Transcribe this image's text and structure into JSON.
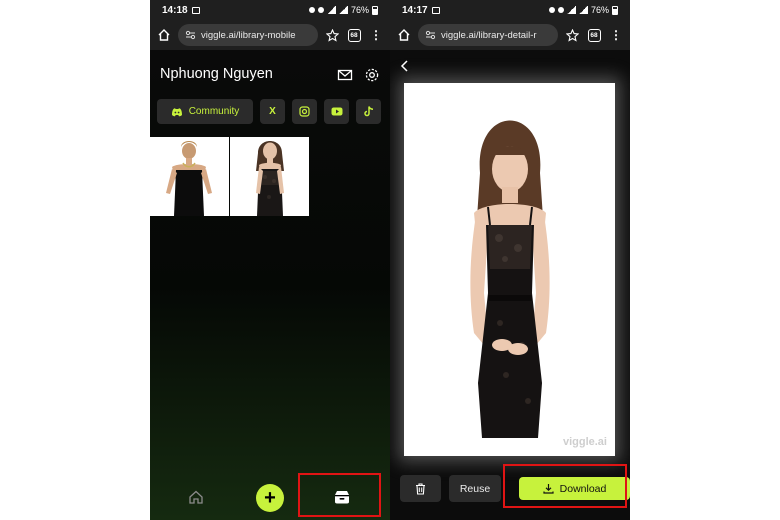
{
  "left_phone": {
    "status": {
      "time": "14:18",
      "battery": "76%"
    },
    "browser": {
      "url": "viggle.ai/library-mobile",
      "tab_count": "68"
    },
    "header": {
      "user_name": "Nphuong Nguyen"
    },
    "social": {
      "community_label": "Community",
      "x_label": "X"
    },
    "thumbnails": [
      "thumbnail-1",
      "thumbnail-2"
    ],
    "bottom_nav": {
      "add_label": "+"
    }
  },
  "right_phone": {
    "status": {
      "time": "14:17",
      "battery": "76%"
    },
    "browser": {
      "url": "viggle.ai/library-detail-r",
      "tab_count": "68"
    },
    "preview": {
      "watermark": "viggle.ai"
    },
    "actions": {
      "reuse_label": "Reuse",
      "download_label": "Download"
    }
  },
  "colors": {
    "accent": "#c7f23c",
    "highlight": "#e01414",
    "chrome": "#1f1f1f",
    "button": "#2b2b2b"
  },
  "icons": [
    "home-icon",
    "star-icon",
    "more-icon",
    "mail-icon",
    "gear-icon",
    "discord-icon",
    "x-icon",
    "instagram-icon",
    "youtube-icon",
    "tiktok-icon",
    "plus-icon",
    "library-icon",
    "back-icon",
    "trash-icon",
    "download-icon"
  ]
}
